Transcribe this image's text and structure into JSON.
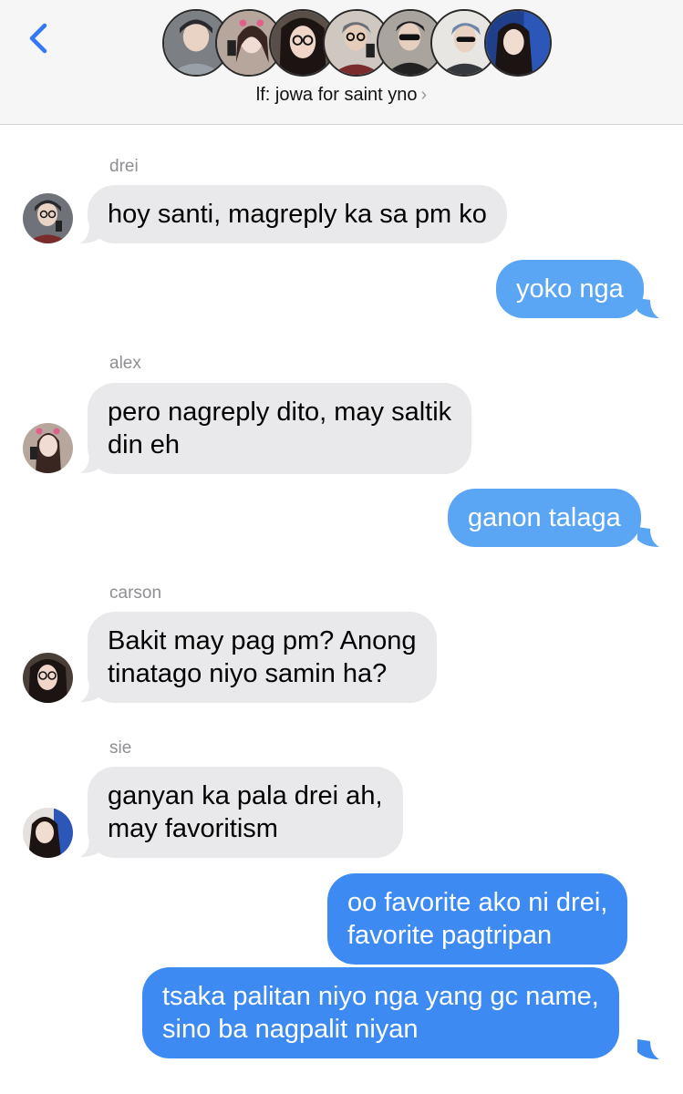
{
  "header": {
    "group_name": "lf: jowa for saint yno",
    "chevron": "›",
    "back_icon": "chevron-left-icon",
    "accent": "#3478f6"
  },
  "members": [
    {
      "name": "drei"
    },
    {
      "name": "alex"
    },
    {
      "name": "carson"
    },
    {
      "name": "member-4"
    },
    {
      "name": "member-5"
    },
    {
      "name": "member-6"
    },
    {
      "name": "sie"
    }
  ],
  "messages": [
    {
      "sender": "drei",
      "text": "hoy santi, magreply ka sa pm ko"
    },
    {
      "sender": "me",
      "text": "yoko nga"
    },
    {
      "sender": "alex",
      "lines": [
        "pero nagreply dito, may saltik",
        "din eh"
      ]
    },
    {
      "sender": "me",
      "text": "ganon talaga"
    },
    {
      "sender": "carson",
      "lines": [
        "Bakit may pag pm? Anong",
        "tinatago niyo samin ha?"
      ]
    },
    {
      "sender": "sie",
      "lines": [
        "ganyan ka pala drei ah,",
        "may favoritism"
      ]
    },
    {
      "sender": "me",
      "lines": [
        "oo favorite ako ni drei,",
        "favorite pagtripan"
      ]
    },
    {
      "sender": "me",
      "lines": [
        "tsaka palitan niyo nga yang gc name,",
        "sino ba nagpalit niyan"
      ]
    }
  ],
  "colors": {
    "incoming_bubble": "#e9e9eb",
    "outgoing_bubble": "#3d8bf2",
    "outgoing_bubble_light": "#5aa6f4",
    "sender_label": "#8e8e93"
  }
}
